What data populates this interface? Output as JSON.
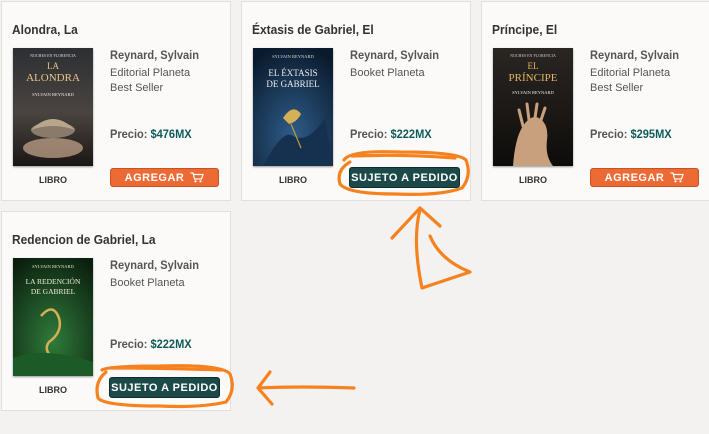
{
  "cards": [
    {
      "title": "Alondra, La",
      "author": "Reynard, Sylvain",
      "publisher": "Editorial Planeta",
      "category": "Best Seller",
      "price_label": "Precio:",
      "price": "$476MX",
      "format": "LIBRO",
      "button": "AGREGAR",
      "cover": {
        "series": "NOCHES EN FLORENCIA",
        "line1": "LA",
        "line2": "ALONDRA",
        "author": "SYLVAIN REYNARD"
      }
    },
    {
      "title": "Éxtasis de Gabriel, El",
      "author": "Reynard, Sylvain",
      "publisher": "Booket Planeta",
      "category": "",
      "price_label": "Precio:",
      "price": "$222MX",
      "format": "LIBRO",
      "button": "SUJETO A PEDIDO",
      "cover": {
        "author": "SYLVAIN REYNARD",
        "line1": "EL ÉXTASIS",
        "line2": "DE GABRIEL"
      }
    },
    {
      "title": "Príncipe, El",
      "author": "Reynard, Sylvain",
      "publisher": "Editorial Planeta",
      "category": "Best Seller",
      "price_label": "Precio:",
      "price": "$295MX",
      "format": "LIBRO",
      "button": "AGREGAR",
      "cover": {
        "series": "NOCHES EN FLORENCIA",
        "line1": "EL",
        "line2": "PRÍNCIPE",
        "author": "SYLVAIN REYNARD"
      }
    },
    {
      "title": "Redencion de Gabriel, La",
      "author": "Reynard, Sylvain",
      "publisher": "Booket Planeta",
      "category": "",
      "price_label": "Precio:",
      "price": "$222MX",
      "format": "LIBRO",
      "button": "SUJETO A PEDIDO",
      "cover": {
        "author": "SYLVAIN REYNARD",
        "line1": "LA REDENCIÓN",
        "line2": "DE GABRIEL"
      }
    }
  ],
  "colors": {
    "accent_add": "#ee6a35",
    "accent_order": "#1b4a48",
    "price": "#0f5a57",
    "annotation": "#f5821f"
  },
  "icons": {
    "add": "cart-icon"
  }
}
